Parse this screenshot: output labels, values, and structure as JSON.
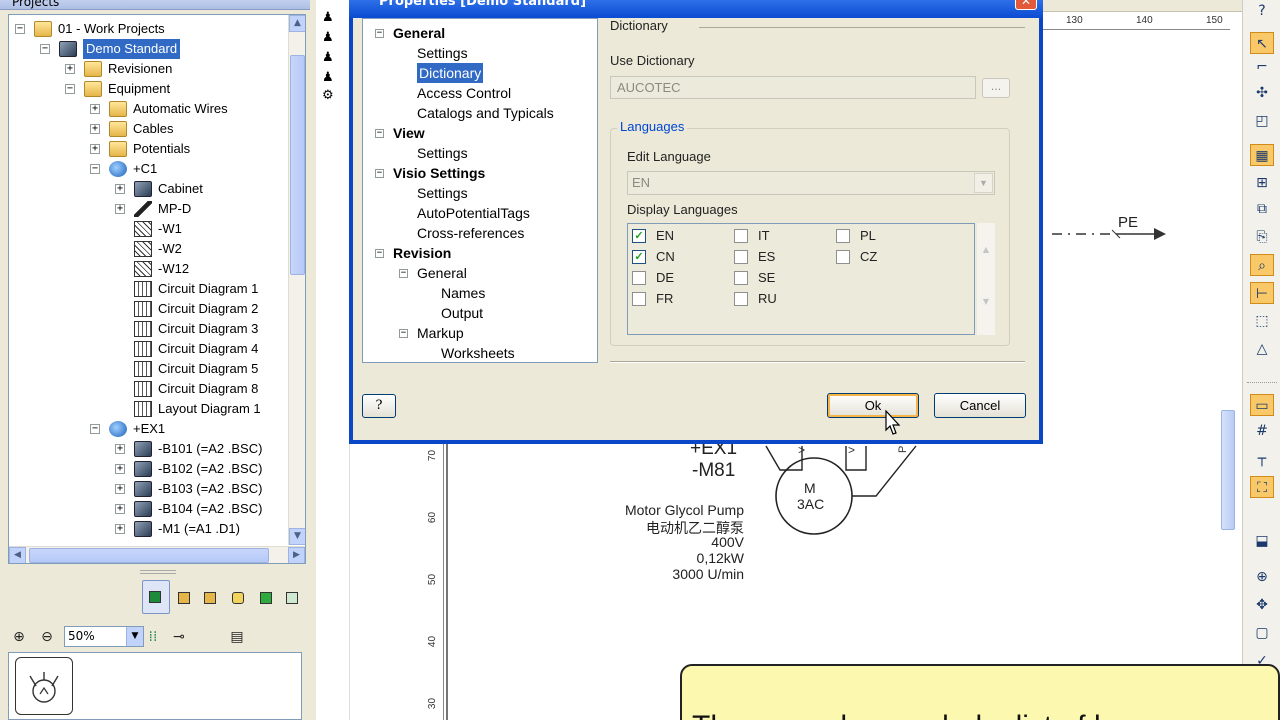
{
  "left_panel": {
    "header": "Projects",
    "tree": [
      {
        "label": "01 - Work Projects",
        "level": 0,
        "expander": "−",
        "icon": "folder-icon"
      },
      {
        "label": "Demo Standard",
        "level": 1,
        "expander": "−",
        "icon": "database-icon",
        "selected": true
      },
      {
        "label": "Revisionen",
        "level": 2,
        "expander": "+",
        "icon": "folder-icon"
      },
      {
        "label": "Equipment",
        "level": 2,
        "expander": "−",
        "icon": "folder-doc-icon"
      },
      {
        "label": "Automatic Wires",
        "level": 3,
        "expander": "+",
        "icon": "folder-icon"
      },
      {
        "label": "Cables",
        "level": 3,
        "expander": "+",
        "icon": "folder-icon"
      },
      {
        "label": "Potentials",
        "level": 3,
        "expander": "+",
        "icon": "folder-icon"
      },
      {
        "label": "+C1",
        "level": 3,
        "expander": "−",
        "icon": "globe-icon"
      },
      {
        "label": "Cabinet",
        "level": 4,
        "expander": "+",
        "icon": "cube-icon"
      },
      {
        "label": "MP-D",
        "level": 4,
        "expander": "+",
        "icon": "plug-icon"
      },
      {
        "label": "-W1",
        "level": 4,
        "expander": "",
        "icon": "wire-icon"
      },
      {
        "label": "-W2",
        "level": 4,
        "expander": "",
        "icon": "wire-icon"
      },
      {
        "label": "-W12",
        "level": 4,
        "expander": "",
        "icon": "wire-icon"
      },
      {
        "label": "Circuit Diagram 1",
        "level": 4,
        "expander": "",
        "icon": "diagram-icon"
      },
      {
        "label": "Circuit Diagram 2",
        "level": 4,
        "expander": "",
        "icon": "diagram-icon"
      },
      {
        "label": "Circuit Diagram 3",
        "level": 4,
        "expander": "",
        "icon": "diagram-icon"
      },
      {
        "label": "Circuit Diagram 4",
        "level": 4,
        "expander": "",
        "icon": "diagram-icon"
      },
      {
        "label": "Circuit Diagram 5",
        "level": 4,
        "expander": "",
        "icon": "diagram-icon"
      },
      {
        "label": "Circuit Diagram 8",
        "level": 4,
        "expander": "",
        "icon": "diagram-icon"
      },
      {
        "label": "Layout Diagram 1",
        "level": 4,
        "expander": "",
        "icon": "diagram-icon"
      },
      {
        "label": "+EX1",
        "level": 3,
        "expander": "−",
        "icon": "globe-icon"
      },
      {
        "label": "-B101  (=A2 .BSC)",
        "level": 4,
        "expander": "+",
        "icon": "cube-icon"
      },
      {
        "label": "-B102  (=A2 .BSC)",
        "level": 4,
        "expander": "+",
        "icon": "cube-icon"
      },
      {
        "label": "-B103  (=A2 .BSC)",
        "level": 4,
        "expander": "+",
        "icon": "cube-icon"
      },
      {
        "label": "-B104  (=A2 .BSC)",
        "level": 4,
        "expander": "+",
        "icon": "cube-icon"
      },
      {
        "label": "-M1  (=A1 .D1)",
        "level": 4,
        "expander": "+",
        "icon": "cube-icon"
      }
    ],
    "zoom_value": "50%"
  },
  "dialog": {
    "title": "Properties [Demo Standard]",
    "nav": [
      {
        "label": "General",
        "indent": 0,
        "bold": true,
        "expander": "−"
      },
      {
        "label": "Settings",
        "indent": 1,
        "bold": false,
        "expander": ""
      },
      {
        "label": "Dictionary",
        "indent": 1,
        "bold": false,
        "expander": "",
        "selected": true
      },
      {
        "label": "Access Control",
        "indent": 1,
        "bold": false,
        "expander": ""
      },
      {
        "label": "Catalogs and Typicals",
        "indent": 1,
        "bold": false,
        "expander": ""
      },
      {
        "label": "View",
        "indent": 0,
        "bold": true,
        "expander": "−"
      },
      {
        "label": "Settings",
        "indent": 1,
        "bold": false,
        "expander": ""
      },
      {
        "label": "Visio Settings",
        "indent": 0,
        "bold": true,
        "expander": "−"
      },
      {
        "label": "Settings",
        "indent": 1,
        "bold": false,
        "expander": ""
      },
      {
        "label": "AutoPotentialTags",
        "indent": 1,
        "bold": false,
        "expander": ""
      },
      {
        "label": "Cross-references",
        "indent": 1,
        "bold": false,
        "expander": ""
      },
      {
        "label": "Revision",
        "indent": 0,
        "bold": true,
        "expander": "−"
      },
      {
        "label": "General",
        "indent": 1,
        "bold": false,
        "expander": "−"
      },
      {
        "label": "Names",
        "indent": 2,
        "bold": false,
        "expander": ""
      },
      {
        "label": "Output",
        "indent": 2,
        "bold": false,
        "expander": ""
      },
      {
        "label": "Markup",
        "indent": 1,
        "bold": false,
        "expander": "−"
      },
      {
        "label": "Worksheets",
        "indent": 2,
        "bold": false,
        "expander": ""
      }
    ],
    "section_title": "Dictionary",
    "use_dictionary_label": "Use Dictionary",
    "use_dictionary_value": "AUCOTEC",
    "browse_label": "...",
    "languages_group": "Languages",
    "edit_language_label": "Edit Language",
    "edit_language_value": "EN",
    "display_languages_label": "Display Languages",
    "languages": [
      {
        "code": "EN",
        "checked": true
      },
      {
        "code": "CN",
        "checked": true
      },
      {
        "code": "DE",
        "checked": false
      },
      {
        "code": "FR",
        "checked": false
      },
      {
        "code": "IT",
        "checked": false
      },
      {
        "code": "ES",
        "checked": false
      },
      {
        "code": "SE",
        "checked": false
      },
      {
        "code": "RU",
        "checked": false
      },
      {
        "code": "PL",
        "checked": false
      },
      {
        "code": "CZ",
        "checked": false
      }
    ],
    "help_label": "?",
    "ok_label": "Ok",
    "cancel_label": "Cancel",
    "close_label": "✕"
  },
  "drawing": {
    "ruler_top": [
      "130",
      "140",
      "150"
    ],
    "ruler_left": [
      "70",
      "60",
      "50",
      "40",
      "30"
    ],
    "pe_label": "PE",
    "device_tag_1": "+EX1",
    "device_tag_2": "-M81",
    "motor_symbol_1": "M",
    "motor_symbol_2": "3AC",
    "desc_lines": [
      "Motor Glycol Pump",
      "电动机乙二醇泵",
      "400V",
      "0,12kW",
      "3000 U/min"
    ]
  },
  "callout": {
    "text": "The one, who needed a list of languages"
  }
}
